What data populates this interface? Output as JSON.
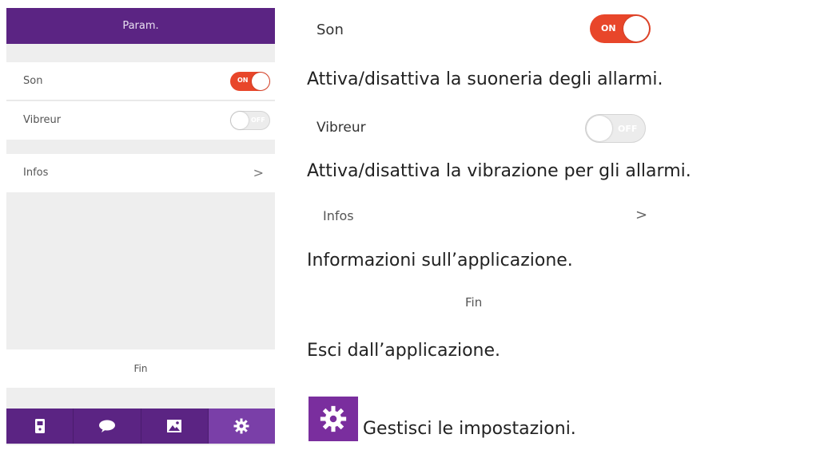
{
  "phone": {
    "header_title": "Param.",
    "rows": {
      "son_label": "Son",
      "son_toggle": "ON",
      "vibreur_label": "Vibreur",
      "vibreur_toggle": "OFF",
      "infos_label": "Infos",
      "infos_chevron": ">"
    },
    "fin_label": "Fin",
    "tabs": [
      {
        "icon": "device-icon"
      },
      {
        "icon": "chat-bubble-icon"
      },
      {
        "icon": "image-icon"
      },
      {
        "icon": "gear-icon",
        "active": true
      }
    ]
  },
  "legend": {
    "son_label": "Son",
    "son_toggle": "ON",
    "son_desc": "Attiva/disattiva la suoneria degli allarmi.",
    "vibreur_label": "Vibreur",
    "vibreur_toggle": "OFF",
    "vibreur_desc": "Attiva/disattiva la vibrazione per gli allarmi.",
    "infos_label": "Infos",
    "infos_chevron": ">",
    "infos_desc": "Informazioni sull’applicazione.",
    "fin_label": "Fin",
    "fin_desc": "Esci dall’applicazione.",
    "settings_icon": "gear-icon",
    "settings_desc": "Gestisci le impostazioni."
  },
  "colors": {
    "brand_purple": "#5b2483",
    "toggle_on": "#e8462a",
    "toggle_off": "#ececec"
  }
}
